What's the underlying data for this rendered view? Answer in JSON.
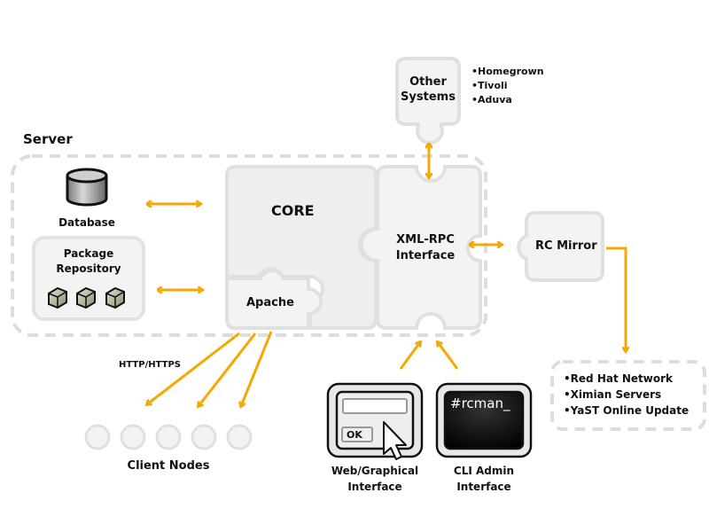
{
  "server": {
    "label": "Server"
  },
  "database": {
    "label": "Database"
  },
  "package_repository": {
    "label_line1": "Package",
    "label_line2": "Repository"
  },
  "core": {
    "label": "CORE"
  },
  "apache": {
    "label": "Apache"
  },
  "xmlrpc": {
    "label_line1": "XML-RPC",
    "label_line2": "Interface"
  },
  "other_systems": {
    "label_line1": "Other",
    "label_line2": "Systems",
    "items": [
      "Homegrown",
      "Tivoli",
      "Aduva"
    ]
  },
  "rc_mirror": {
    "label": "RC Mirror"
  },
  "upstream_sources": {
    "items": [
      "Red Hat Network",
      "Ximian Servers",
      "YaST Online Update"
    ]
  },
  "protocol": {
    "label": "HTTP/HTTPS"
  },
  "client_nodes": {
    "label": "Client Nodes",
    "count": 5
  },
  "web_interface": {
    "label_line1": "Web/Graphical",
    "label_line2": "Interface",
    "button_label": "OK"
  },
  "cli_interface": {
    "label_line1": "CLI Admin",
    "label_line2": "Interface",
    "prompt": "#rcman_"
  },
  "colors": {
    "arrow": "#f5a800",
    "panel": "#f3f3f3",
    "panel_border": "#e0e0e0",
    "dashed": "#dddddd"
  }
}
